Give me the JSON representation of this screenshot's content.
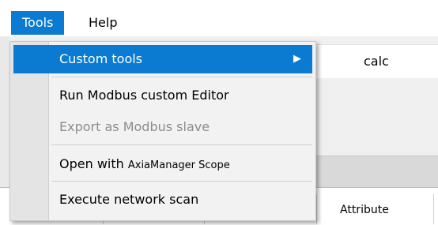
{
  "menubar": {
    "items": [
      {
        "label": "Tools"
      },
      {
        "label": "Help"
      }
    ]
  },
  "background": {
    "field_value": "calc",
    "column_header": "Attribute"
  },
  "dropdown": {
    "custom_tools": "Custom tools",
    "submenu_arrow": "▶",
    "run_modbus_editor": "Run Modbus custom Editor",
    "export_modbus_slave": "Export as Modbus slave",
    "open_with_prefix": "Open with",
    "open_with_app": "AxiaManager Scope",
    "execute_network_scan": "Execute network scan"
  },
  "colors": {
    "accent": "#0a7bd1",
    "menu_background": "#f2f2f2",
    "disabled_text": "#8c8c8c"
  }
}
